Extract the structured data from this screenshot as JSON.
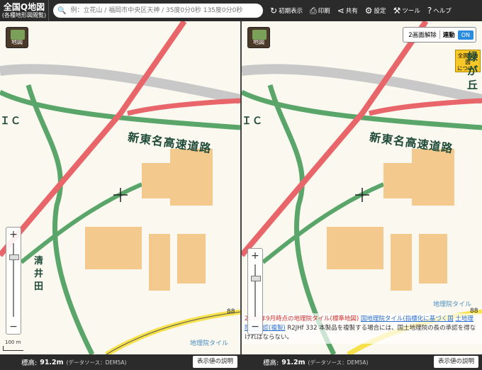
{
  "header": {
    "logo_title": "全国Q地図",
    "logo_subtitle": "(各種地形図閲覧)",
    "search_placeholder": "例：立花山 / 福岡市中央区天神 / 35度0分0秒 135度0分0秒",
    "buttons": [
      {
        "label": "初期表示",
        "icon": "refresh-icon"
      },
      {
        "label": "印刷",
        "icon": "printer-icon"
      },
      {
        "label": "共有",
        "icon": "share-icon"
      },
      {
        "label": "設定",
        "icon": "gear-icon"
      },
      {
        "label": "ツール",
        "icon": "tool-icon"
      },
      {
        "label": "ヘルプ",
        "icon": "help-icon"
      }
    ]
  },
  "map": {
    "button_label": "地図",
    "road_label": "新東名高速道路",
    "place_kiyoi": "清井田",
    "place_midori": "緑が丘",
    "elevation_mark": "88",
    "gsi_tile": "地理院タイル",
    "scale": "100 m",
    "right_ic": "ＩＣ",
    "left_ic": "ＩＣ"
  },
  "dual": {
    "exit_label": "2画面解除",
    "sync_label": "連動",
    "toggle_state": "ON",
    "badge_line1": "全国Q地図",
    "badge_line2": "について"
  },
  "attribution": {
    "red_text": "2020年9月時点の地理院タイル(標準地図)",
    "link1": "国地理院タイル(指標化に基づく国",
    "link2": "土地理院長承認(複製)",
    "text": " R2JHf 332 本製品を複製する場合には、国土地理院の長の承認を得なければならない。"
  },
  "bottom": {
    "elev_label": "標高:",
    "elev_value": "91.2m",
    "source": "(データソース：DEM5A)",
    "explain_button": "表示値の説明"
  },
  "colors": {
    "topbar": "#2b2b2b",
    "road_green": "#5aa66a",
    "road_red": "#e8666a",
    "building_orange": "#f4c98d",
    "accent_blue": "#2b8cde"
  }
}
